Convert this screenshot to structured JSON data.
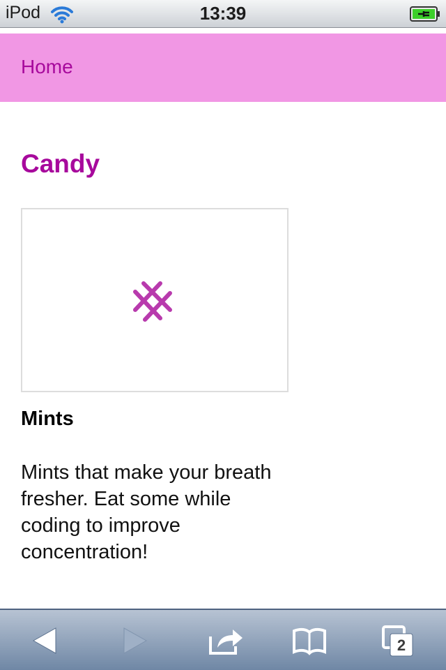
{
  "status_bar": {
    "carrier": "iPod",
    "time": "13:39",
    "icons": [
      "wifi-icon",
      "battery-charging-icon"
    ]
  },
  "nav": {
    "home_label": "Home"
  },
  "main": {
    "title": "Candy",
    "product": {
      "image_icon": "crossed-mint-icon",
      "name": "Mints",
      "description": "Mints that make your breath fresher. Eat some while coding to improve concentration!"
    }
  },
  "toolbar": {
    "icons": [
      "back-arrow-icon",
      "forward-arrow-icon",
      "share-icon",
      "bookmarks-icon",
      "tabs-icon"
    ],
    "tab_count": "2"
  },
  "colors": {
    "accent": "#a7099c",
    "nav_background": "#f197e4"
  }
}
